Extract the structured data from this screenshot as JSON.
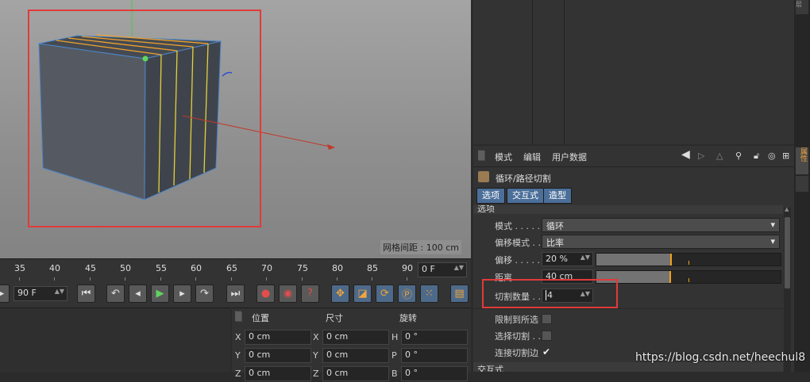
{
  "viewport": {
    "grid_spacing": "网格间距 : 100 cm"
  },
  "timeline": {
    "ticks": [
      "35",
      "40",
      "45",
      "50",
      "55",
      "60",
      "65",
      "70",
      "75",
      "80",
      "85",
      "90"
    ],
    "current_frame": "0 F"
  },
  "transport": {
    "fps_field": "90 F",
    "icons": [
      "go-to-start-icon",
      "previous-key-icon",
      "play-backward-icon",
      "play-icon",
      "next-key-icon",
      "loop-icon",
      "go-to-end-icon",
      "record-icon",
      "autokey-icon",
      "keyframe-selection-icon",
      "move-icon",
      "scale-icon",
      "rotate-icon",
      "param-icon",
      "points-icon",
      "film-icon"
    ]
  },
  "coords": {
    "headers": {
      "position": "位置",
      "size": "尺寸",
      "rotation": "旋转"
    },
    "rows": [
      {
        "a": "X",
        "a_val": "0 cm",
        "b": "X",
        "b_val": "0 cm",
        "c": "H",
        "c_val": "0 °"
      },
      {
        "a": "Y",
        "a_val": "0 cm",
        "b": "Y",
        "b_val": "0 cm",
        "c": "P",
        "c_val": "0 °"
      },
      {
        "a": "Z",
        "a_val": "0 cm",
        "b": "Z",
        "b_val": "0 cm",
        "c": "B",
        "c_val": "0 °"
      }
    ]
  },
  "attributes": {
    "menu": [
      "模式",
      "编辑",
      "用户数据"
    ],
    "tool_name": "循环/路径切割",
    "tabs": [
      "选项",
      "交互式",
      "造型"
    ],
    "section_options": "选项",
    "section_interactive": "交互式",
    "props": {
      "mode_label": "模式 . . . . . .",
      "mode_value": "循环",
      "offset_mode_label": "偏移模式 . .",
      "offset_mode_value": "比率",
      "offset_label": "偏移 . . . . . .",
      "offset_value": "20 %",
      "offset_fraction": 0.2,
      "distance_label": "距离 . . . . . .",
      "distance_value": "40 cm",
      "cuts_label": "切割数量 . .",
      "cuts_value": "4",
      "restrict_label": "限制到所选",
      "select_cuts_label": "选择切割 . .",
      "connect_cuts_label": "连接切割边"
    },
    "checks": {
      "restrict": false,
      "select_cuts": false,
      "connect_cuts": true
    }
  },
  "side_strip": {
    "top": "层",
    "mid": "属性"
  },
  "watermark": "https://blog.csdn.net/heechul8"
}
